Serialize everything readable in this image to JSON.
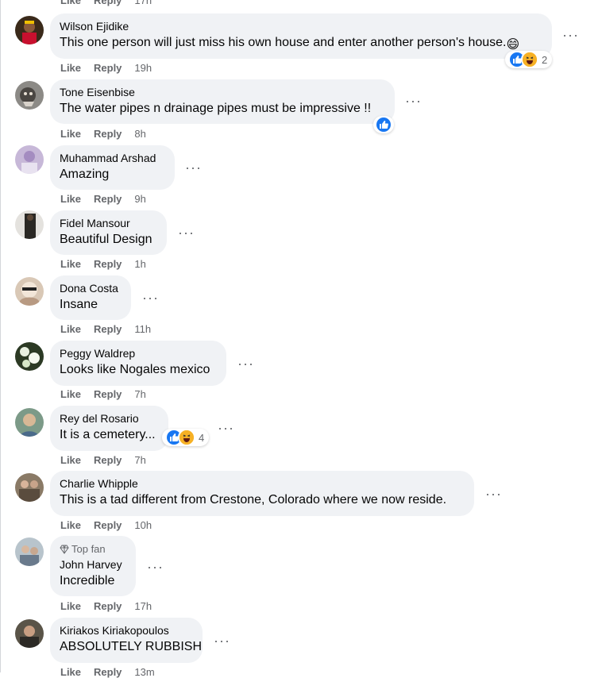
{
  "colors": {
    "like_blue": "#1877f2",
    "haha_yellow": "#f7b125",
    "bubble_bg": "#f0f2f5",
    "meta_gray": "#65676b"
  },
  "actions": {
    "like": "Like",
    "reply": "Reply"
  },
  "top_partial": {
    "like": "Like",
    "reply": "Reply",
    "time": "17h"
  },
  "comments": [
    {
      "author": "Wilson Ejidike",
      "text": "This one person will just miss his own house and enter another person's house.",
      "emoji": "😄",
      "time": "19h",
      "reactions": [
        "like",
        "haha"
      ],
      "reaction_count": "2"
    },
    {
      "author": "Tone Eisenbise",
      "text": "The water pipes n drainage pipes must be impressive !!",
      "time": "8h",
      "reactions": [
        "like"
      ]
    },
    {
      "author": "Muhammad Arshad",
      "text": "Amazing",
      "time": "9h"
    },
    {
      "author": "Fidel Mansour",
      "text": "Beautiful Design",
      "time": "1h"
    },
    {
      "author": "Dona Costa",
      "text": "Insane",
      "time": "11h"
    },
    {
      "author": "Peggy Waldrep",
      "text": "Looks like Nogales mexico",
      "time": "7h"
    },
    {
      "author": "Rey del Rosario",
      "text": "It is a cemetery...",
      "time": "7h",
      "reactions": [
        "like",
        "haha"
      ],
      "reaction_count": "4"
    },
    {
      "author": "Charlie Whipple",
      "text": "This is a tad different from Crestone, Colorado where we now reside.",
      "time": "10h"
    },
    {
      "author": "John Harvey",
      "badge": "Top fan",
      "text": "Incredible",
      "time": "17h"
    },
    {
      "author": "Kiriakos Kiriakopoulos",
      "text": "ABSOLUTELY RUBBISH",
      "time": "13m"
    }
  ]
}
